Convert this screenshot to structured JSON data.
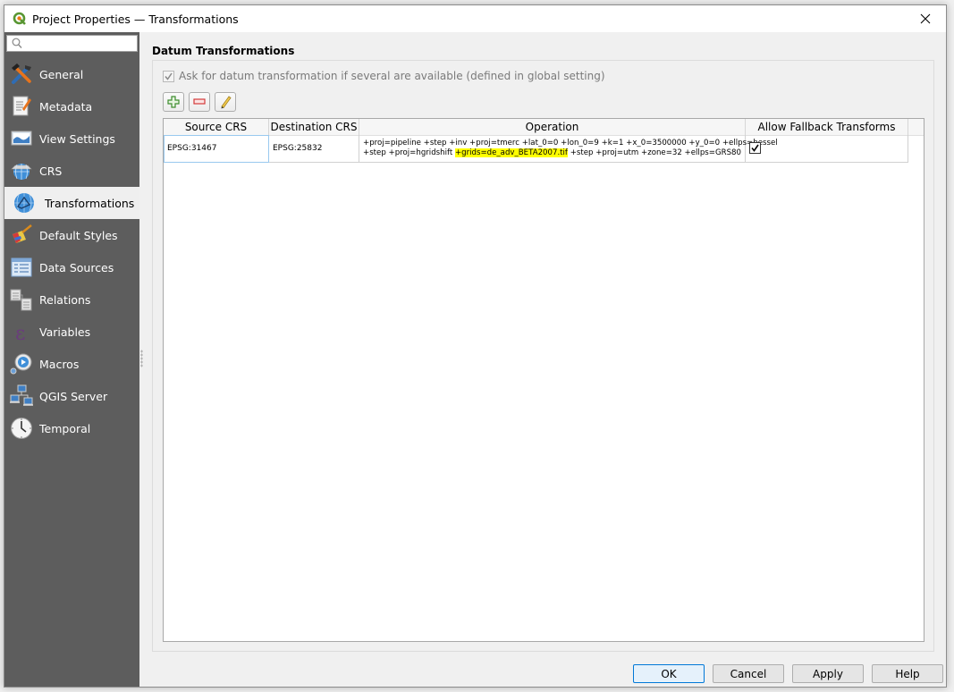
{
  "window": {
    "title": "Project Properties — Transformations",
    "app_icon": "qgis-logo-icon",
    "close_icon": "close-icon"
  },
  "sidebar": {
    "search": {
      "value": "",
      "placeholder": ""
    },
    "items": [
      {
        "label": "General",
        "icon": "tools-icon",
        "active": false
      },
      {
        "label": "Metadata",
        "icon": "metadata-document-icon",
        "active": false
      },
      {
        "label": "View Settings",
        "icon": "view-settings-map-icon",
        "active": false
      },
      {
        "label": "CRS",
        "icon": "crs-globe-icon",
        "active": false
      },
      {
        "label": "Transformations",
        "icon": "transformations-globe-icon",
        "active": true
      },
      {
        "label": "Default Styles",
        "icon": "paint-brush-icon",
        "active": false
      },
      {
        "label": "Data Sources",
        "icon": "data-sources-table-icon",
        "active": false
      },
      {
        "label": "Relations",
        "icon": "relations-tables-icon",
        "active": false
      },
      {
        "label": "Variables",
        "icon": "epsilon-icon",
        "active": false
      },
      {
        "label": "Macros",
        "icon": "macros-gear-icon",
        "active": false
      },
      {
        "label": "QGIS Server",
        "icon": "server-network-icon",
        "active": false
      },
      {
        "label": "Temporal",
        "icon": "clock-icon",
        "active": false
      }
    ]
  },
  "main": {
    "group_title": "Datum Transformations",
    "ask_checkbox": {
      "label": "Ask for datum transformation if several are available (defined in global setting)",
      "checked": true,
      "enabled": false
    },
    "toolbar": {
      "add_icon": "plus-icon",
      "remove_icon": "minus-icon",
      "edit_icon": "pencil-icon"
    },
    "table": {
      "columns": [
        "Source CRS",
        "Destination CRS",
        "Operation",
        "Allow Fallback Transforms"
      ],
      "rows": [
        {
          "source_crs": "EPSG:31467",
          "destination_crs": "EPSG:25832",
          "operation_line1": "+proj=pipeline +step +inv +proj=tmerc +lat_0=0 +lon_0=9 +k=1 +x_0=3500000 +y_0=0 +ellps=bessel",
          "operation_line2_before": "+step +proj=hgridshift ",
          "operation_line2_highlight": "+grids=de_adv_BETA2007.tif",
          "operation_line2_after": " +step +proj=utm +zone=32 +ellps=GRS80",
          "allow_fallback": true
        }
      ]
    }
  },
  "buttons": {
    "ok": "OK",
    "cancel": "Cancel",
    "apply": "Apply",
    "help": "Help"
  },
  "colors": {
    "sidebar_bg": "#5d5d5d",
    "highlight": "#ffff00",
    "default_button_border": "#0078d7"
  }
}
